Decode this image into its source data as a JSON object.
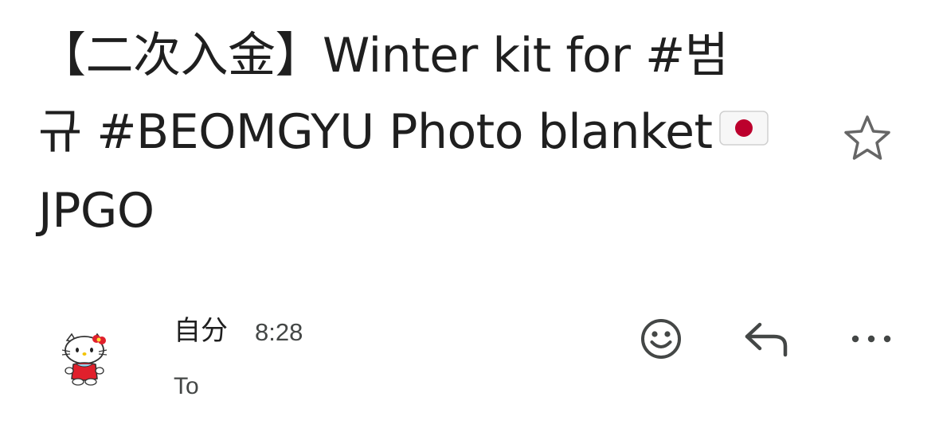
{
  "subject": {
    "line1": "【二次入金】Winter kit for #범",
    "line2": "규 #BEOMGYU Photo blanket",
    "line3": "JPGO"
  },
  "icons": {
    "flag": "japan-flag-icon",
    "star": "star-outline-icon",
    "avatar": "hello-kitty-avatar",
    "emoji": "smiley-face-icon",
    "reply": "reply-arrow-icon",
    "more": "more-horizontal-icon"
  },
  "message": {
    "sender": "自分",
    "time": "8:28",
    "recipient": "To"
  },
  "colors": {
    "text": "#1f1f1f",
    "secondary": "#444746",
    "flag_red": "#bc002d",
    "kitty_red": "#e0202c"
  }
}
